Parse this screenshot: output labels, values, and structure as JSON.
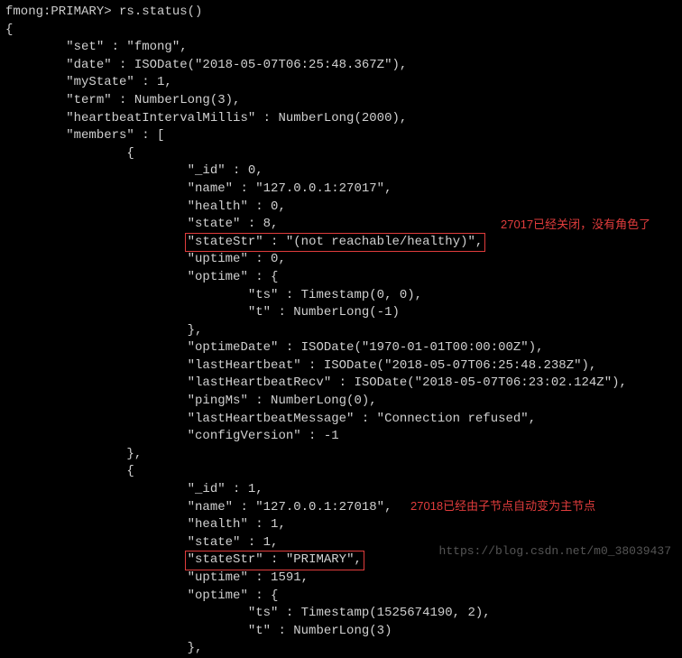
{
  "prompt": "fmong:PRIMARY>",
  "command": "rs.status()",
  "annotations": {
    "a1": "27017已经关闭，没有角色了",
    "a2": "27018已经由子节点自动变为主节点"
  },
  "watermark": "https://blog.csdn.net/m0_38039437",
  "lines": {
    "l_open": "{",
    "l_set": "        \"set\" : \"fmong\",",
    "l_date": "        \"date\" : ISODate(\"2018-05-07T06:25:48.367Z\"),",
    "l_mystate": "        \"myState\" : 1,",
    "l_term": "        \"term\" : NumberLong(3),",
    "l_hb": "        \"heartbeatIntervalMillis\" : NumberLong(2000),",
    "l_members": "        \"members\" : [",
    "l_m0_open": "                {",
    "l_m0_id": "                        \"_id\" : 0,",
    "l_m0_name": "                        \"name\" : \"127.0.0.1:27017\",",
    "l_m0_health": "                        \"health\" : 0,",
    "l_m0_state": "                        \"state\" : 8,",
    "l_m0_stateStr_pre": "                        ",
    "l_m0_stateStr_box": "\"stateStr\" : \"(not reachable/healthy)\",",
    "l_m0_uptime": "                        \"uptime\" : 0,",
    "l_m0_optime": "                        \"optime\" : {",
    "l_m0_ts": "                                \"ts\" : Timestamp(0, 0),",
    "l_m0_t": "                                \"t\" : NumberLong(-1)",
    "l_m0_optime_close": "                        },",
    "l_m0_optimeDate": "                        \"optimeDate\" : ISODate(\"1970-01-01T00:00:00Z\"),",
    "l_m0_lastHb": "                        \"lastHeartbeat\" : ISODate(\"2018-05-07T06:25:48.238Z\"),",
    "l_m0_lastHbRecv": "                        \"lastHeartbeatRecv\" : ISODate(\"2018-05-07T06:23:02.124Z\"),",
    "l_m0_ping": "                        \"pingMs\" : NumberLong(0),",
    "l_m0_lastMsg": "                        \"lastHeartbeatMessage\" : \"Connection refused\",",
    "l_m0_cfg": "                        \"configVersion\" : -1",
    "l_m0_close": "                },",
    "l_m1_open": "                {",
    "l_m1_id": "                        \"_id\" : 1,",
    "l_m1_name": "                        \"name\" : \"127.0.0.1:27018\",",
    "l_m1_health": "                        \"health\" : 1,",
    "l_m1_state": "                        \"state\" : 1,",
    "l_m1_stateStr_pre": "                        ",
    "l_m1_stateStr_box": "\"stateStr\" : \"PRIMARY\",",
    "l_m1_uptime": "                        \"uptime\" : 1591,",
    "l_m1_optime": "                        \"optime\" : {",
    "l_m1_ts": "                                \"ts\" : Timestamp(1525674190, 2),",
    "l_m1_t": "                                \"t\" : NumberLong(3)",
    "l_m1_optime_close": "                        },"
  }
}
